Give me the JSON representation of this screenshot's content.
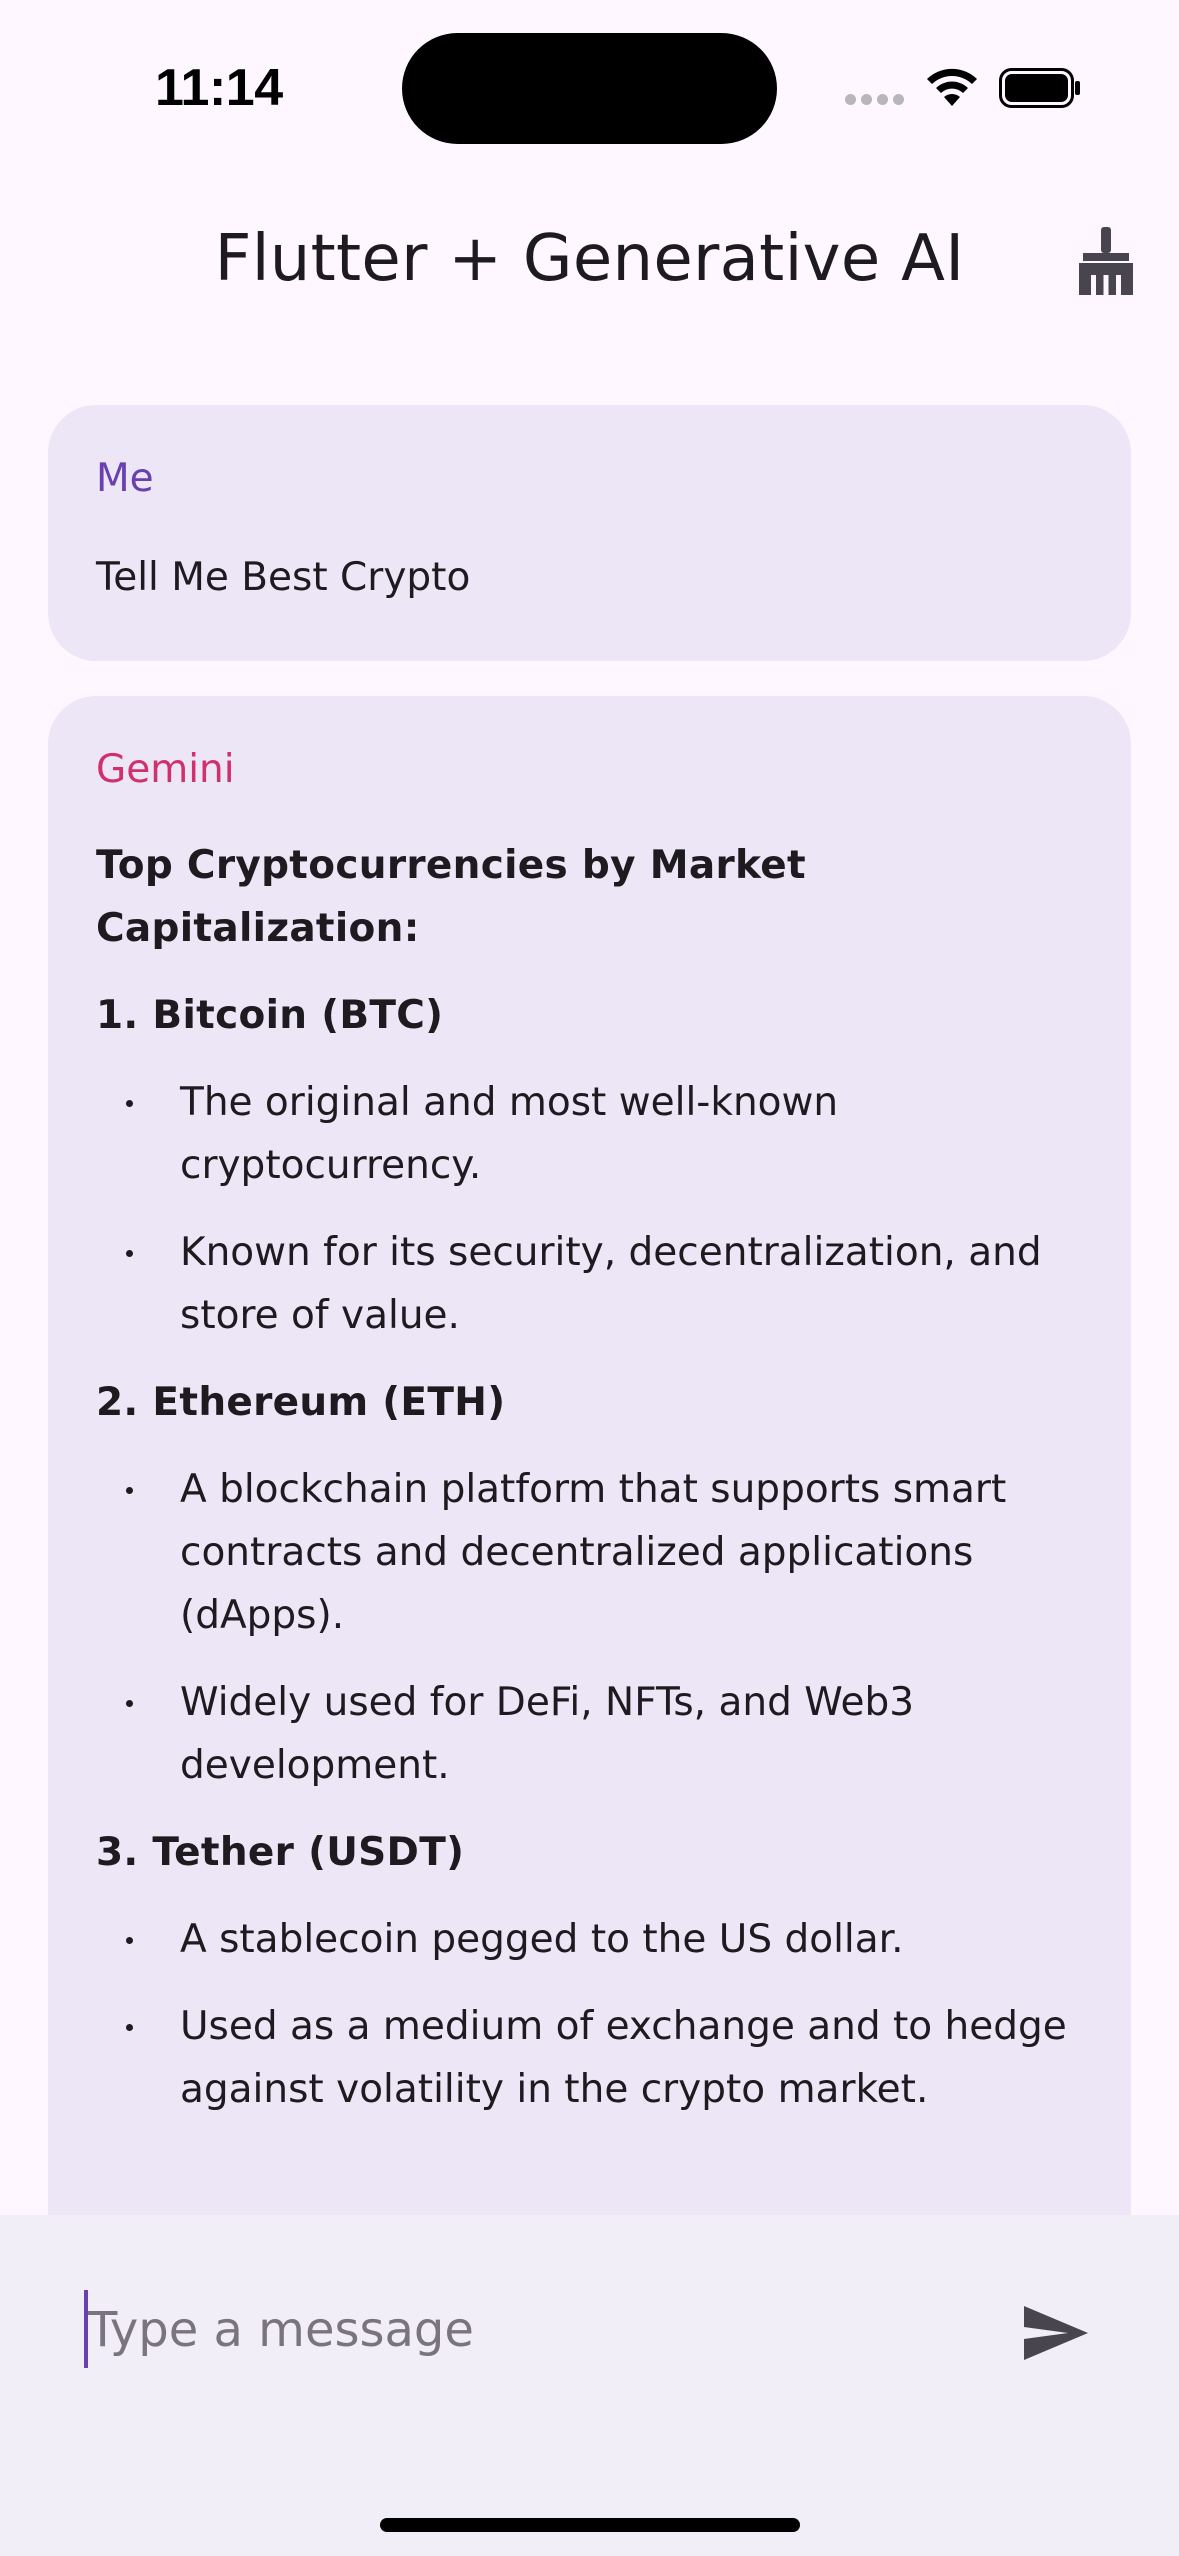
{
  "status_bar": {
    "time": "11:14"
  },
  "app_bar": {
    "title": "Flutter + Generative AI",
    "clear_icon": "broom-icon"
  },
  "chat": {
    "user_message": {
      "sender": "Me",
      "text": "Tell Me Best Crypto"
    },
    "ai_message": {
      "sender": "Gemini",
      "heading": "Top Cryptocurrencies by Market Capitalization:",
      "items": [
        {
          "title": "1. Bitcoin (BTC)",
          "bullets": [
            "The original and most well-known cryptocurrency.",
            "Known for its security, decentralization, and store of value."
          ]
        },
        {
          "title": "2. Ethereum (ETH)",
          "bullets": [
            "A blockchain platform that supports smart contracts and decentralized applications (dApps).",
            "Widely used for DeFi, NFTs, and Web3 development."
          ]
        },
        {
          "title": "3. Tether (USDT)",
          "bullets": [
            "A stablecoin pegged to the US dollar.",
            "Used as a medium of exchange and to hedge against volatility in the crypto market."
          ]
        }
      ]
    }
  },
  "composer": {
    "placeholder": "Type a message",
    "value": "",
    "send_icon": "send-icon"
  },
  "colors": {
    "background": "#fef7ff",
    "bubble": "#ede6f6",
    "sender_me": "#6a3fb0",
    "sender_ai": "#d0306c",
    "composer_bg": "#f2eef8"
  }
}
